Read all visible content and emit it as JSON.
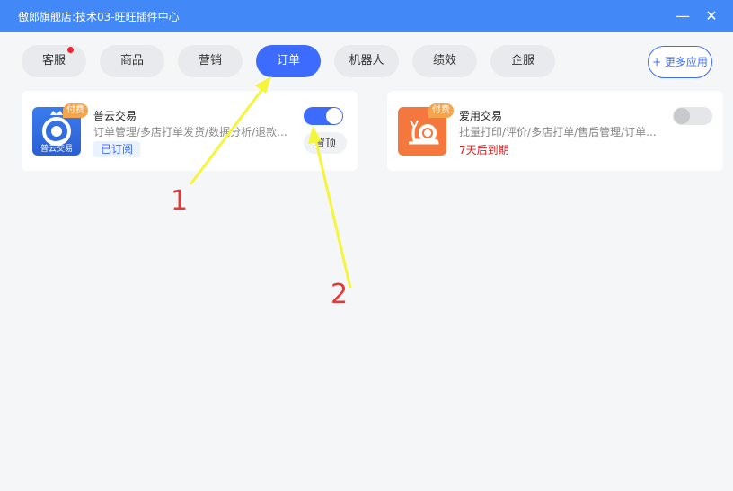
{
  "window": {
    "title": "傲郎旗舰店:技术03-旺旺插件中心",
    "minimize": "—",
    "close": "✕"
  },
  "tabs": [
    {
      "label": "客服",
      "has_dot": true
    },
    {
      "label": "商品"
    },
    {
      "label": "营销"
    },
    {
      "label": "订单",
      "active": true
    },
    {
      "label": "机器人"
    },
    {
      "label": "绩效"
    },
    {
      "label": "企服"
    }
  ],
  "more_apps": "+ 更多应用",
  "apps": [
    {
      "name": "普云交易",
      "desc": "订单管理/多店打单发货/数据分析/退款...",
      "badge": "付费",
      "icon_caption": "普云交易",
      "status": "已订阅",
      "toggle_on": true,
      "pin_label": "置顶",
      "icon": "crown-logo-icon"
    },
    {
      "name": "爱用交易",
      "desc": "批量打印/评价/多店打单/售后管理/订单...",
      "badge": "付费",
      "expire": "7天后到期",
      "toggle_on": false,
      "icon": "snail-icon"
    }
  ],
  "annotations": {
    "num_1": "1",
    "num_2": "2"
  },
  "colors": {
    "titlebar": "#4288f7",
    "accent": "#3d6bfd",
    "arrow": "#f5f53a",
    "annotation": "#e03a3a",
    "expire": "#e02020"
  }
}
